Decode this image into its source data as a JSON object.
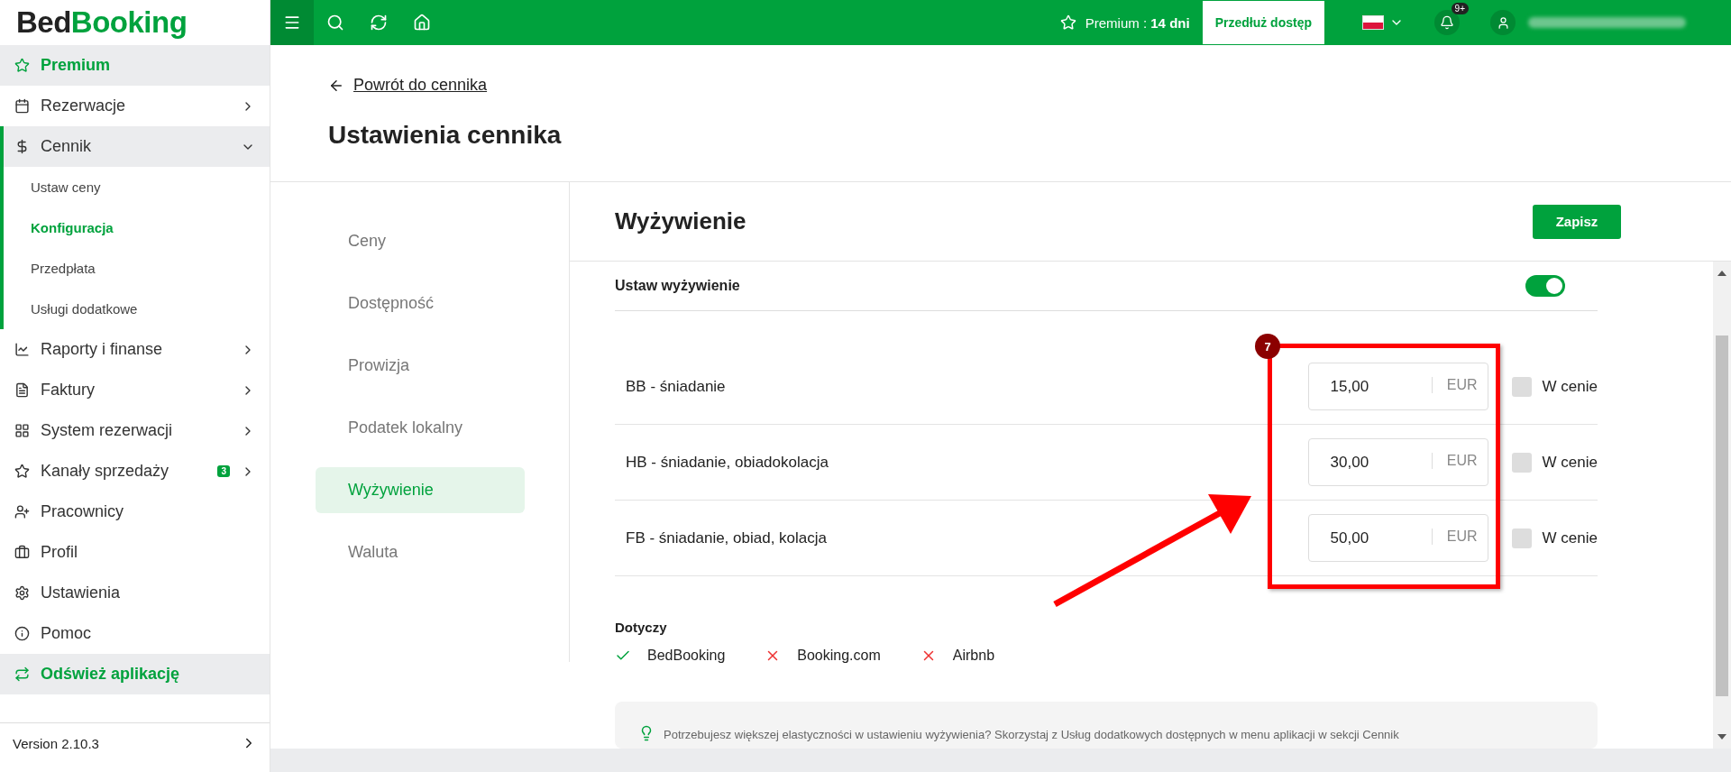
{
  "logo": {
    "part_1": "Bed",
    "part_2": "Booking"
  },
  "topbar": {
    "premium_label": "Premium :",
    "premium_days": "14 dni",
    "extend_button": "Przedłuż dostęp",
    "notifications_badge": "9+"
  },
  "sidebar": {
    "items": [
      {
        "kind": "highlight",
        "label": "Premium"
      },
      {
        "kind": "nav",
        "label": "Rezerwacje",
        "expanded": false,
        "has_arrow": true
      },
      {
        "kind": "nav",
        "label": "Cennik",
        "expanded": true,
        "has_arrow": true,
        "children": [
          {
            "label": "Ustaw ceny",
            "selected": false
          },
          {
            "label": "Konfiguracja",
            "selected": true
          },
          {
            "label": "Przedpłata",
            "selected": false
          },
          {
            "label": "Usługi dodatkowe",
            "selected": false
          }
        ]
      },
      {
        "kind": "nav",
        "label": "Raporty i finanse",
        "expanded": false,
        "has_arrow": true
      },
      {
        "kind": "nav",
        "label": "Faktury",
        "expanded": false,
        "has_arrow": true
      },
      {
        "kind": "nav",
        "label": "System rezerwacji",
        "expanded": false,
        "has_arrow": true
      },
      {
        "kind": "nav",
        "label": "Kanały sprzedaży",
        "expanded": false,
        "has_arrow": true,
        "badge": "3"
      },
      {
        "kind": "nav",
        "label": "Pracownicy",
        "expanded": false,
        "has_arrow": false
      },
      {
        "kind": "nav",
        "label": "Profil",
        "expanded": false,
        "has_arrow": false
      },
      {
        "kind": "nav",
        "label": "Ustawienia",
        "expanded": false,
        "has_arrow": false
      },
      {
        "kind": "nav",
        "label": "Pomoc",
        "expanded": false,
        "has_arrow": false
      },
      {
        "kind": "highlight",
        "label": "Odśwież aplikację"
      }
    ],
    "version": "Version 2.10.3"
  },
  "back_link": "Powrót do cennika",
  "page_title": "Ustawienia cennika",
  "settings_tabs": [
    {
      "label": "Ceny",
      "selected": false
    },
    {
      "label": "Dostępność",
      "selected": false
    },
    {
      "label": "Prowizja",
      "selected": false
    },
    {
      "label": "Podatek lokalny",
      "selected": false
    },
    {
      "label": "Wyżywienie",
      "selected": true
    },
    {
      "label": "Waluta",
      "selected": false
    }
  ],
  "section": {
    "title": "Wyżywienie",
    "save_button": "Zapisz"
  },
  "toggle": {
    "label": "Ustaw wyżywienie",
    "on": true
  },
  "meals": [
    {
      "name": "BB - śniadanie",
      "price": "15,00",
      "currency": "EUR",
      "included_label": "W cenie",
      "included": false
    },
    {
      "name": "HB - śniadanie, obiadokolacja",
      "price": "30,00",
      "currency": "EUR",
      "included_label": "W cenie",
      "included": false
    },
    {
      "name": "FB - śniadanie, obiad, kolacja",
      "price": "50,00",
      "currency": "EUR",
      "included_label": "W cenie",
      "included": false
    }
  ],
  "applies": {
    "title": "Dotyczy",
    "channels": [
      {
        "name": "BedBooking",
        "enabled": true
      },
      {
        "name": "Booking.com",
        "enabled": false
      },
      {
        "name": "Airbnb",
        "enabled": false
      }
    ]
  },
  "tip": "Potrzebujesz większej elastyczności w ustawieniu wyżywienia? Skorzystaj z Usług dodatkowych dostępnych w menu aplikacji w sekcji Cennik",
  "annotation": {
    "number": "7"
  }
}
